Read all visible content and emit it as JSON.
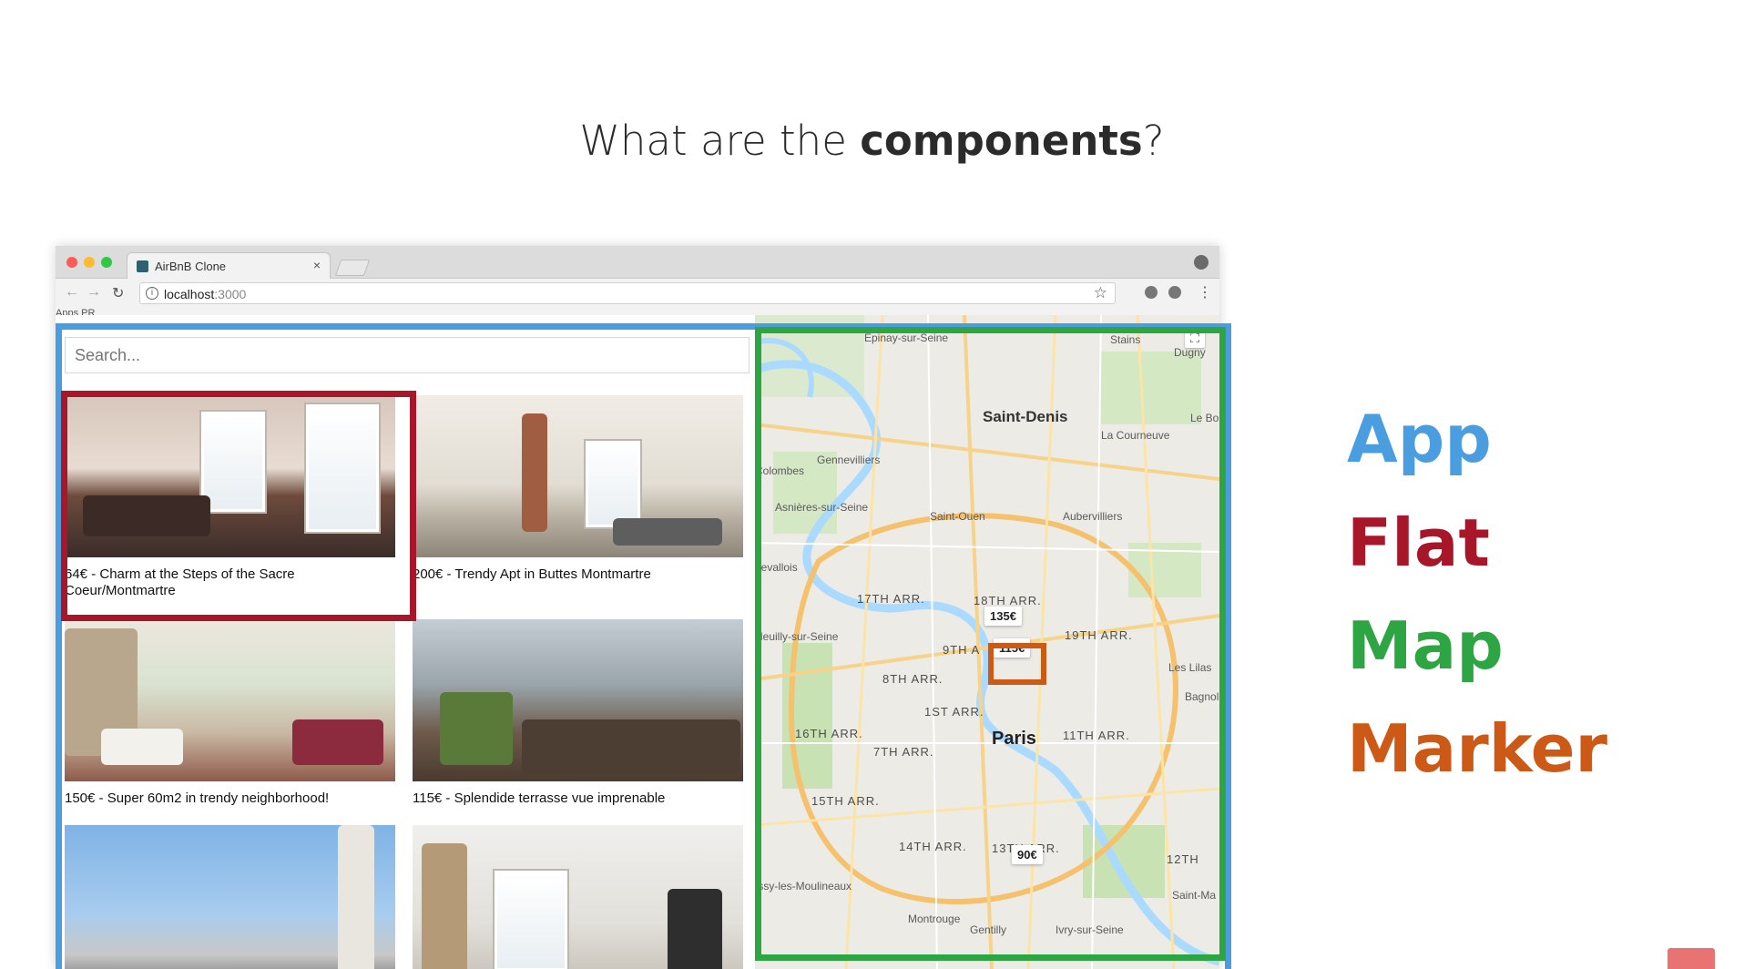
{
  "slide": {
    "title_plain": "What are the ",
    "title_bold": "components",
    "title_end": "?"
  },
  "browser": {
    "tab_title": "AirBnB Clone",
    "tab_close": "×",
    "url_host": "localhost",
    "url_port": ":3000",
    "bookmarks_text": "Apps   PR"
  },
  "app": {
    "search_placeholder": "Search...",
    "flats": [
      {
        "caption": "64€ - Charm at the Steps of the Sacre Coeur/Montmartre"
      },
      {
        "caption": "200€ - Trendy Apt in Buttes Montmartre"
      },
      {
        "caption": "150€ - Super 60m2 in trendy neighborhood!"
      },
      {
        "caption": "115€ - Splendide terrasse vue imprenable"
      },
      {
        "caption": ""
      },
      {
        "caption": ""
      }
    ]
  },
  "map": {
    "cities": [
      "Saint-Denis",
      "Paris"
    ],
    "towns": [
      "Épinay-sur-Seine",
      "Stains",
      "Dugny",
      "Le Bou",
      "La Courneuve",
      "Gennevilliers",
      "Asnières-sur-Seine",
      "Saint-Ouen",
      "Aubervilliers",
      "Levallois",
      "Bagnolet",
      "Les Lilas",
      "Montrouge",
      "Gentilly",
      "Ivry-sur-Seine",
      "Issy-les-Moulineaux",
      "Saint-Ma",
      "Neuilly-sur-Seine",
      "Colombes"
    ],
    "arrondissements": [
      "17TH ARR.",
      "18TH ARR.",
      "19TH ARR.",
      "9TH A",
      "8TH ARR.",
      "1ST ARR.",
      "16TH ARR.",
      "7TH ARR.",
      "11TH ARR.",
      "15TH ARR.",
      "14TH ARR.",
      "13TH ARR.",
      "12TH"
    ],
    "markers": [
      "135€",
      "115€",
      "90€"
    ]
  },
  "legend": {
    "app": "App",
    "flat": "Flat",
    "map": "Map",
    "marker": "Marker"
  },
  "colors": {
    "app": "#4a9ee0",
    "flat": "#a8162a",
    "map": "#2ea543",
    "marker": "#cc5a16"
  }
}
